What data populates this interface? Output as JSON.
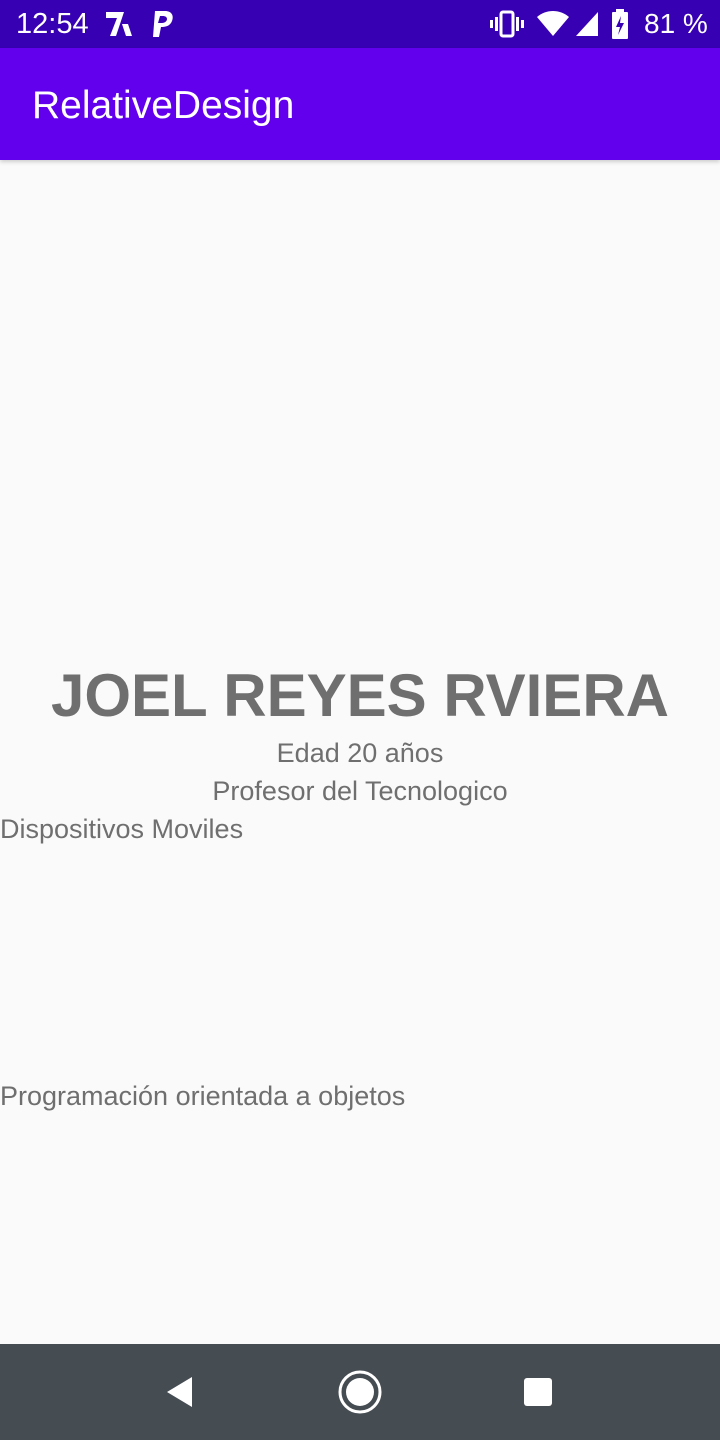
{
  "status_bar": {
    "time": "12:54",
    "battery_text": "81 %",
    "icons": [
      "app-notification-icon",
      "paypal-icon",
      "vibrate-icon",
      "wifi-icon",
      "cell-signal-icon",
      "battery-charging-icon"
    ],
    "background": "#3700b3"
  },
  "app_bar": {
    "title": "RelativeDesign",
    "background": "#6200ee"
  },
  "main": {
    "name": "JOEL REYES RVIERA",
    "age": "Edad 20 años",
    "role": "Profesor del Tecnologico",
    "course_1": "Dispositivos Moviles",
    "course_2": "Programación orientada a objetos",
    "text_color": "#6f6f6f"
  },
  "nav_bar": {
    "buttons": [
      "back-icon",
      "home-icon",
      "recents-icon"
    ],
    "background": "#454c52"
  }
}
